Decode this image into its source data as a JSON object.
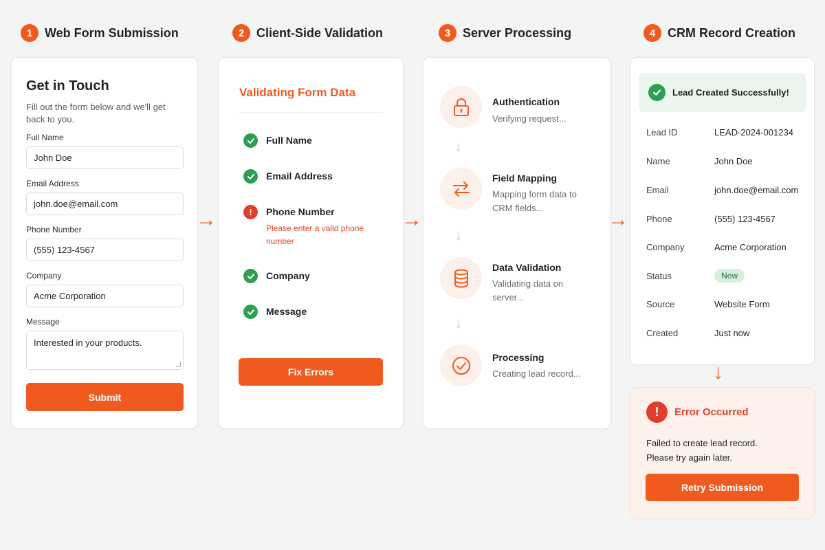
{
  "steps": [
    {
      "num": "1",
      "title": "Web Form Submission"
    },
    {
      "num": "2",
      "title": "Client-Side Validation"
    },
    {
      "num": "3",
      "title": "Server Processing"
    },
    {
      "num": "4",
      "title": "CRM Record Creation"
    }
  ],
  "form": {
    "title": "Get in Touch",
    "subtitle": "Fill out the form below and we'll get back to you.",
    "fields": [
      {
        "label": "Full Name",
        "value": "John Doe"
      },
      {
        "label": "Email Address",
        "value": "john.doe@email.com"
      },
      {
        "label": "Phone Number",
        "value": "(555) 123-4567"
      },
      {
        "label": "Company",
        "value": "Acme Corporation"
      },
      {
        "label": "Message",
        "value": "Interested in your products."
      }
    ],
    "submit_label": "Submit"
  },
  "validation": {
    "title": "Validating Form Data",
    "items": [
      {
        "label": "Full Name",
        "status": "ok"
      },
      {
        "label": "Email Address",
        "status": "ok"
      },
      {
        "label": "Phone Number",
        "status": "error",
        "error": "Please enter a valid phone number"
      },
      {
        "label": "Company",
        "status": "ok"
      },
      {
        "label": "Message",
        "status": "ok"
      }
    ],
    "fix_label": "Fix Errors"
  },
  "server": {
    "stages": [
      {
        "icon": "lock-icon",
        "title": "Authentication",
        "desc": "Verifying request..."
      },
      {
        "icon": "arrows-swap-icon",
        "title": "Field Mapping",
        "desc": "Mapping form data to CRM fields..."
      },
      {
        "icon": "database-icon",
        "title": "Data Validation",
        "desc": "Validating data on server..."
      },
      {
        "icon": "check-circle-icon",
        "title": "Processing",
        "desc": "Creating lead record..."
      }
    ]
  },
  "crm": {
    "success_text": "Lead Created Successfully!",
    "rows": [
      {
        "key": "Lead ID",
        "value": "LEAD-2024-001234"
      },
      {
        "key": "Name",
        "value": "John Doe"
      },
      {
        "key": "Email",
        "value": "john.doe@email.com"
      },
      {
        "key": "Phone",
        "value": "(555) 123-4567"
      },
      {
        "key": "Company",
        "value": "Acme Corporation"
      },
      {
        "key": "Status",
        "value": "New"
      },
      {
        "key": "Source",
        "value": "Website Form"
      },
      {
        "key": "Created",
        "value": "Just now"
      }
    ]
  },
  "error": {
    "title": "Error Occurred",
    "line1": "Failed to create lead record.",
    "line2": "Please try again later.",
    "retry_label": "Retry Submission"
  },
  "colors": {
    "accent": "#f05a1f",
    "success": "#2e9e52",
    "error": "#e03e2d"
  }
}
